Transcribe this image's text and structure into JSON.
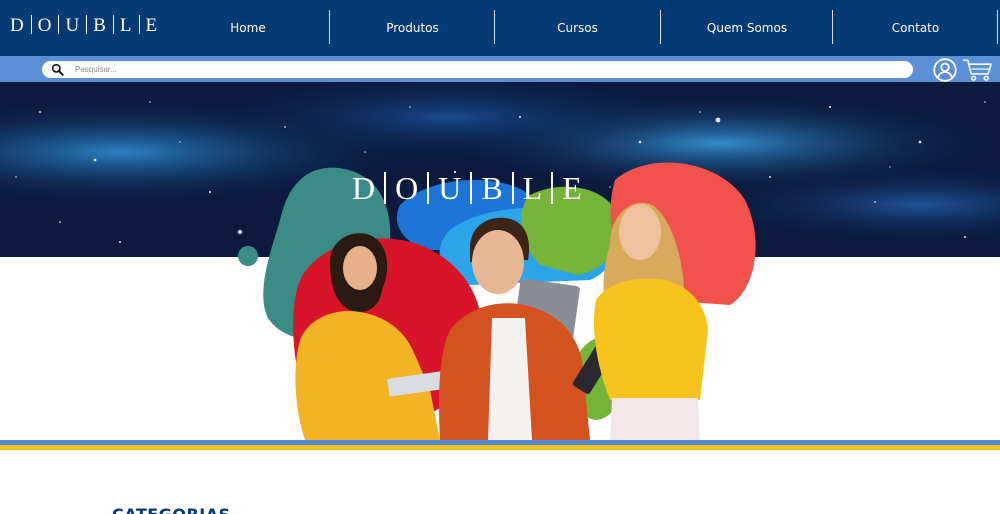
{
  "brand": {
    "letters": [
      "D",
      "O",
      "U",
      "B",
      "L",
      "E"
    ]
  },
  "nav": {
    "items": [
      {
        "label": "Home"
      },
      {
        "label": "Produtos"
      },
      {
        "label": "Cursos"
      },
      {
        "label": "Quem Somos"
      },
      {
        "label": "Contato"
      }
    ]
  },
  "search": {
    "placeholder": "Pesquisar...",
    "value": ""
  },
  "icons": {
    "search": "search-icon",
    "account": "user-icon",
    "cart": "cart-icon"
  },
  "hero": {
    "letters": [
      "D",
      "O",
      "U",
      "B",
      "L",
      "E"
    ]
  },
  "sections": {
    "categories_title": "CATEGORIAS"
  },
  "colors": {
    "nav_bg": "#063a74",
    "search_bar_bg": "#5b8fd8",
    "stripe_blue": "#4f8ad6",
    "stripe_yellow": "#f4c21a",
    "blob_teal": "#3b8c86",
    "blob_red": "#d7142a",
    "blob_blue": "#1b74d6",
    "blob_green": "#76b33a",
    "blob_coral": "#f2524e"
  }
}
